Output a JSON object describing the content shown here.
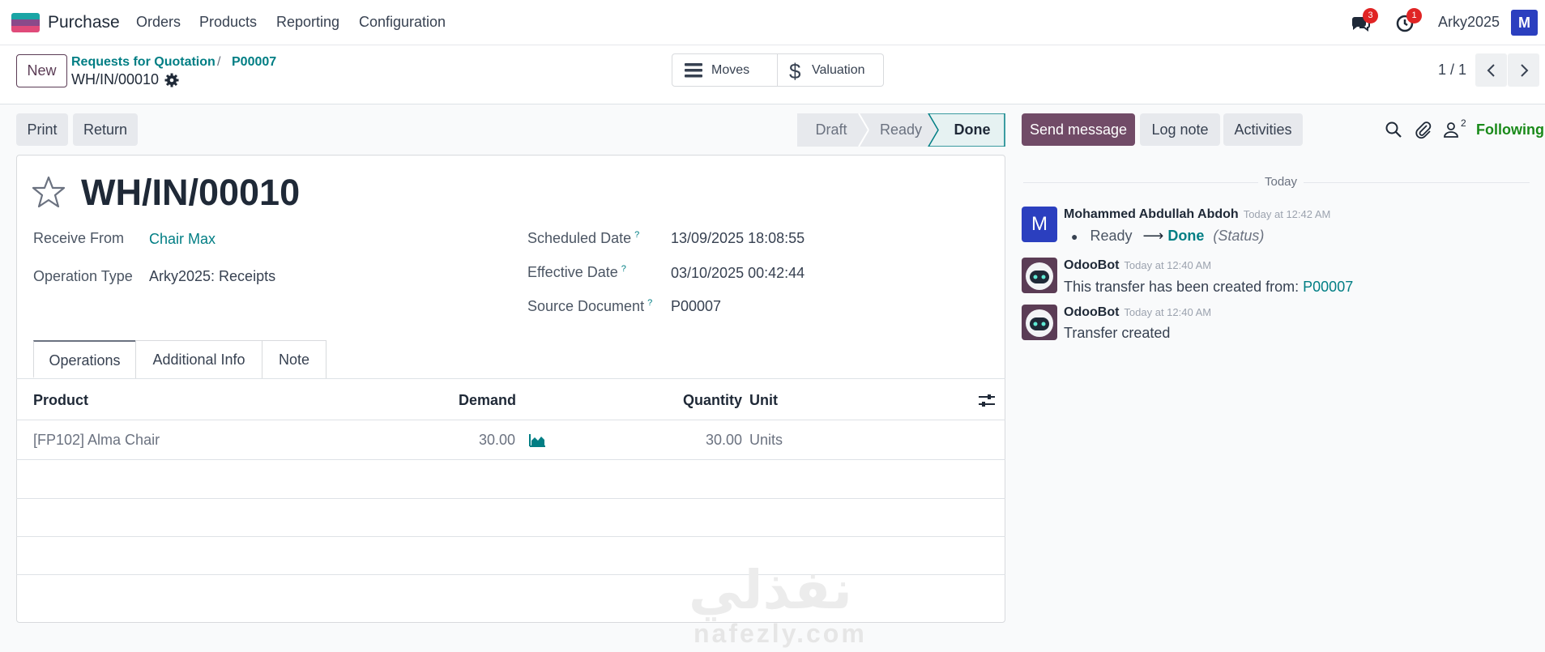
{
  "navbar": {
    "app_name": "Purchase",
    "menu": [
      "Orders",
      "Products",
      "Reporting",
      "Configuration"
    ],
    "messages_count": "3",
    "activities_count": "1",
    "user_name": "Arky2025",
    "avatar_letter": "M"
  },
  "control": {
    "new_label": "New",
    "breadcrumb": [
      "Requests for Quotation",
      "P00007"
    ],
    "record_name": "WH/IN/00010",
    "smart_buttons": [
      "Moves",
      "Valuation"
    ],
    "pager": "1 / 1"
  },
  "actions": {
    "print": "Print",
    "return": "Return"
  },
  "statusbar": {
    "stages": [
      "Draft",
      "Ready",
      "Done"
    ],
    "current": "Done"
  },
  "form": {
    "title": "WH/IN/00010",
    "fields": {
      "receive_from_label": "Receive From",
      "receive_from_value": "Chair Max",
      "operation_type_label": "Operation Type",
      "operation_type_value": "Arky2025: Receipts",
      "scheduled_date_label": "Scheduled Date",
      "scheduled_date_value": "13/09/2025 18:08:55",
      "effective_date_label": "Effective Date",
      "effective_date_value": "03/10/2025 00:42:44",
      "source_document_label": "Source Document",
      "source_document_value": "P00007",
      "help_mark": "?"
    },
    "tabs": [
      "Operations",
      "Additional Info",
      "Note"
    ],
    "table": {
      "headers": [
        "Product",
        "Demand",
        "Quantity",
        "Unit"
      ],
      "rows": [
        {
          "product": "[FP102] Alma Chair",
          "demand": "30.00",
          "quantity": "30.00",
          "unit": "Units"
        }
      ]
    }
  },
  "chatter": {
    "send_message": "Send message",
    "log_note": "Log note",
    "activities": "Activities",
    "followers_count": "2",
    "following": "Following",
    "day_separator": "Today",
    "messages": [
      {
        "avatar_letter": "M",
        "author": "Mohammed Abdullah Abdoh",
        "date": "Today at 12:42 AM",
        "from": "Ready",
        "to": "Done",
        "field": "(Status)"
      },
      {
        "author": "OdooBot",
        "date": "Today at 12:40 AM",
        "text": "This transfer has been created from:",
        "link": "P00007"
      },
      {
        "author": "OdooBot",
        "date": "Today at 12:40 AM",
        "text": "Transfer created"
      }
    ]
  },
  "watermark": {
    "arabic": "نفذلي",
    "latin": "nafezly.com"
  },
  "colors": {
    "primary": "#714b67",
    "teal": "#017e84",
    "green": "#1a8a1a",
    "badge": "#e02424"
  }
}
